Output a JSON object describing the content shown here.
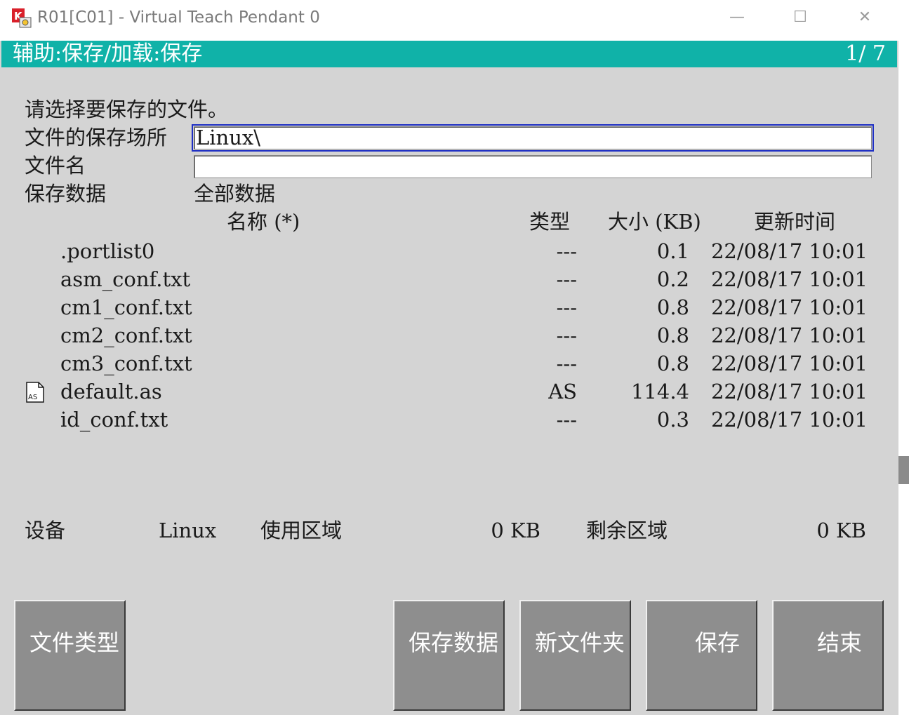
{
  "window": {
    "title": "R01[C01] - Virtual Teach Pendant 0",
    "minimize": "—",
    "maximize": "☐",
    "close": "✕"
  },
  "header": {
    "title": "辅助:保存/加载:保存",
    "page": "1/  7"
  },
  "form": {
    "prompt": "请选择要保存的文件。",
    "location_label": "文件的保存场所",
    "location_value": "Linux\\",
    "filename_label": "文件名",
    "filename_value": "",
    "savedata_label": "保存数据",
    "savedata_value": "全部数据"
  },
  "table": {
    "headers": {
      "name": "名称  (*)",
      "type": "类型",
      "size": "大小 (KB)",
      "updated": "更新时间"
    },
    "rows": [
      {
        "name": ".portlist0",
        "type": "---",
        "size": "0.1",
        "updated": "22/08/17 10:01",
        "icon": ""
      },
      {
        "name": "asm_conf.txt",
        "type": "---",
        "size": "0.2",
        "updated": "22/08/17 10:01",
        "icon": ""
      },
      {
        "name": "cm1_conf.txt",
        "type": "---",
        "size": "0.8",
        "updated": "22/08/17 10:01",
        "icon": ""
      },
      {
        "name": "cm2_conf.txt",
        "type": "---",
        "size": "0.8",
        "updated": "22/08/17 10:01",
        "icon": ""
      },
      {
        "name": "cm3_conf.txt",
        "type": "---",
        "size": "0.8",
        "updated": "22/08/17 10:01",
        "icon": ""
      },
      {
        "name": "default.as",
        "type": "AS",
        "size": "114.4",
        "updated": "22/08/17 10:01",
        "icon": "AS"
      },
      {
        "name": "id_conf.txt",
        "type": "---",
        "size": "0.3",
        "updated": "22/08/17 10:01",
        "icon": ""
      }
    ]
  },
  "device": {
    "label": "设备",
    "value": "Linux",
    "used_label": "使用区域",
    "used_value": "0 KB",
    "free_label": "剩余区域",
    "free_value": "0 KB"
  },
  "buttons": {
    "file_type": "文件类型",
    "save_data": "保存数据",
    "new_folder": "新文件夹",
    "save": "保存",
    "end": "结束"
  },
  "colors": {
    "header_bg": "#10b2a8",
    "panel_bg": "#d4d4d4",
    "button_bg": "#8e8e8e",
    "focus_outline": "#1e2fc4"
  }
}
